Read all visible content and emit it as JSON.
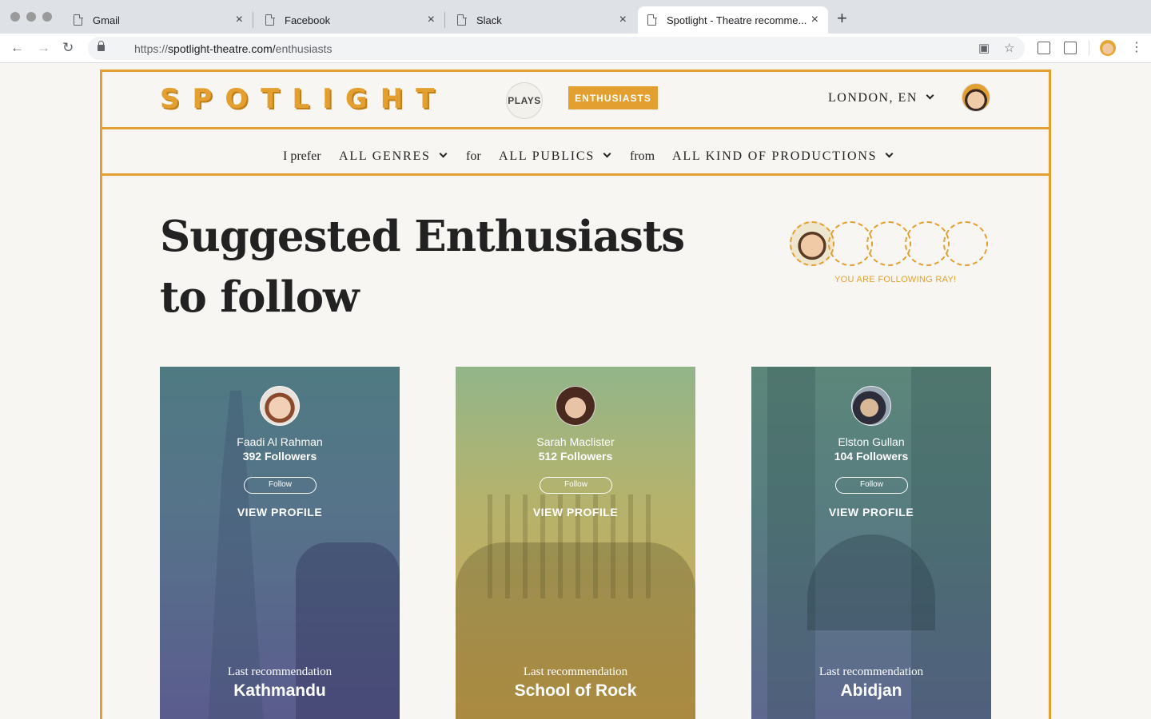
{
  "browser": {
    "tabs": [
      {
        "label": "Gmail",
        "active": false
      },
      {
        "label": "Facebook",
        "active": false
      },
      {
        "label": "Slack",
        "active": false
      },
      {
        "label": "Spotlight - Theatre recomme...",
        "active": true
      }
    ],
    "url_scheme": "https://",
    "url_host": "spotlight-theatre.com/",
    "url_path": "enthusiasts",
    "close_glyph": "×",
    "newtab_glyph": "+"
  },
  "header": {
    "logo": "SPOTLIGHT",
    "nav_plays": "PLAYS",
    "nav_enthusiasts": "ENTHUSIASTS",
    "location": "LONDON, EN"
  },
  "filters": {
    "prefix": "I prefer",
    "genre": "ALL GENRES",
    "for_word": "for",
    "publics": "ALL PUBLICS",
    "from_word": "from",
    "productions": "ALL KIND OF PRODUCTIONS"
  },
  "main": {
    "title_line1": "Suggested Enthusiasts",
    "title_line2": "to follow",
    "following_status": "YOU ARE FOLLOWING RAY!",
    "following_slots_filled": 1,
    "following_slots_total": 5
  },
  "cards": [
    {
      "name": "Faadi Al Rahman",
      "followers": "392 Followers",
      "follow_label": "Follow",
      "view_label": "VIEW PROFILE",
      "last_label": "Last recommendation",
      "last_play": "Kathmandu"
    },
    {
      "name": "Sarah Maclister",
      "followers": "512 Followers",
      "follow_label": "Follow",
      "view_label": "VIEW PROFILE",
      "last_label": "Last recommendation",
      "last_play": "School of Rock"
    },
    {
      "name": "Elston Gullan",
      "followers": "104 Followers",
      "follow_label": "Follow",
      "view_label": "VIEW PROFILE",
      "last_label": "Last recommendation",
      "last_play": "Abidjan"
    }
  ],
  "colors": {
    "accent": "#e3a031",
    "background": "#f8f6f2",
    "text": "#222222"
  }
}
